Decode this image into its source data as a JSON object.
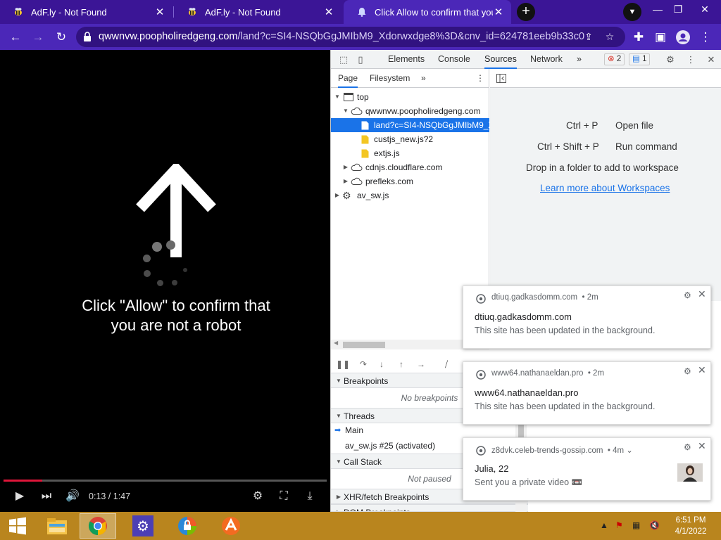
{
  "browser": {
    "tabs": [
      {
        "label": "AdF.ly - Not Found",
        "close": "✕"
      },
      {
        "label": "AdF.ly - Not Found",
        "close": "✕"
      },
      {
        "label": "Click Allow to confirm that you a",
        "close": "✕"
      }
    ],
    "new_tab": "+",
    "url_domain": "qwwnvw.poopholiredgeng.com",
    "url_path": "/land?c=SI4-NSQbGgJMIbM9_Xdorwxdge8%3D&cnv_id=624781eeb9b33c0..."
  },
  "video": {
    "message": "Click \"Allow\" to confirm that you are not a robot",
    "time": "0:13 / 1:47",
    "progress": 0.12
  },
  "devtools": {
    "tabs": [
      "Elements",
      "Console",
      "Sources",
      "Network"
    ],
    "more": "»",
    "errors": "2",
    "messages": "1",
    "nav_tabs": [
      "Page",
      "Filesystem"
    ],
    "tree": [
      {
        "label": "top"
      },
      {
        "label": "qwwnvw.poopholiredgeng.com"
      },
      {
        "label": "land?c=SI4-NSQbGgJMIbM9_X"
      },
      {
        "label": "custjs_new.js?2"
      },
      {
        "label": "extjs.js"
      },
      {
        "label": "cdnjs.cloudflare.com"
      },
      {
        "label": "prefleks.com"
      },
      {
        "label": "av_sw.js"
      }
    ],
    "shortcuts": [
      {
        "keys": "Ctrl + P",
        "action": "Open file"
      },
      {
        "keys": "Ctrl + Shift + P",
        "action": "Run command"
      }
    ],
    "drop_hint": "Drop in a folder to add to workspace",
    "workspace_link": "Learn more about Workspaces",
    "sections": {
      "breakpoints": "Breakpoints",
      "no_breakpoints": "No breakpoints",
      "threads": "Threads",
      "main_thread": "Main",
      "sw_thread": "av_sw.js #25 (activated)",
      "call_stack": "Call Stack",
      "not_paused": "Not paused",
      "xhr": "XHR/fetch Breakpoints",
      "dom": "DOM Breakpoints"
    }
  },
  "notifications": [
    {
      "source": "dtiuq.gadkasdomm.com",
      "time": "• 2m",
      "title": "dtiuq.gadkasdomm.com",
      "body": "This site has been updated in the background."
    },
    {
      "source": "www64.nathanaeldan.pro",
      "time": "• 2m",
      "title": "www64.nathanaeldan.pro",
      "body": "This site has been updated in the background."
    },
    {
      "source": "z8dvk.celeb-trends-gossip.com",
      "time": "• 4m ⌄",
      "title": "Julia, 22",
      "body": "Sent you a private video 📼"
    }
  ],
  "taskbar": {
    "time": "6:51 PM",
    "date": "4/1/2022"
  },
  "colors": {
    "chrome_purple": "#4b27b8",
    "devtools_accent": "#1a73e8",
    "taskbar": "#b9851e"
  }
}
